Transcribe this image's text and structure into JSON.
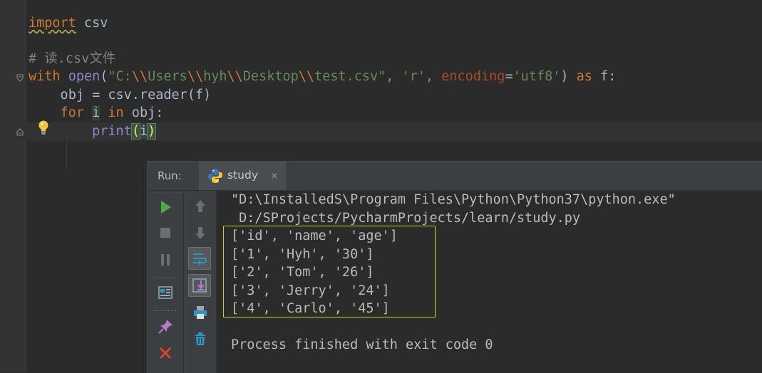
{
  "editor": {
    "line1": {
      "kw": "import",
      "rest": " csv"
    },
    "line3": {
      "comment": "# 读.csv文件"
    },
    "line4": {
      "kw_with": "with",
      "sp1": " ",
      "fn_open": "open",
      "p1": "(",
      "s1": "\"C:",
      "e1": "\\\\",
      "s2": "Users",
      "e2": "\\\\",
      "s3": "hyh",
      "e3": "\\\\",
      "s4": "Desktop",
      "e4": "\\\\",
      "s5": "test.csv\"",
      "c1": ", ",
      "s6": "'r'",
      "c2": ", ",
      "param": "encoding",
      "eq": "=",
      "s7": "'utf8'",
      "p2": ") ",
      "kw_as": "as",
      "rest": " f:"
    },
    "line5": {
      "text": "    obj = csv.reader(f)"
    },
    "line6": {
      "indent": "    ",
      "kw_for": "for",
      "sp": " ",
      "var": "i",
      "sp2": " ",
      "kw_in": "in",
      "rest": " obj:"
    },
    "line7": {
      "indent": "        ",
      "fn_print": "print",
      "p1": "(",
      "arg": "i",
      "p2": ")"
    }
  },
  "run": {
    "label": "Run:",
    "tab_name": "study",
    "close_glyph": "×",
    "console": {
      "cmd_line1": "\"D:\\InstalledS\\Program Files\\Python\\Python37\\python.exe\"",
      "cmd_line2": " D:/SProjects/PycharmProjects/learn/study.py",
      "rows": [
        "['id', 'name', 'age']",
        "['1', 'Hyh', '30']",
        "['2', 'Tom', '26']",
        "['3', 'Jerry', '24']",
        "['4', 'Carlo', '45']"
      ],
      "exit_message": "Process finished with exit code 0"
    }
  },
  "colors": {
    "keyword": "#cc7832",
    "string": "#6a8759",
    "builtin": "#8888c6",
    "comment": "#808080",
    "run_green": "#4fa849",
    "stop_red": "#d9452c",
    "output_box": "#c8d22c"
  }
}
